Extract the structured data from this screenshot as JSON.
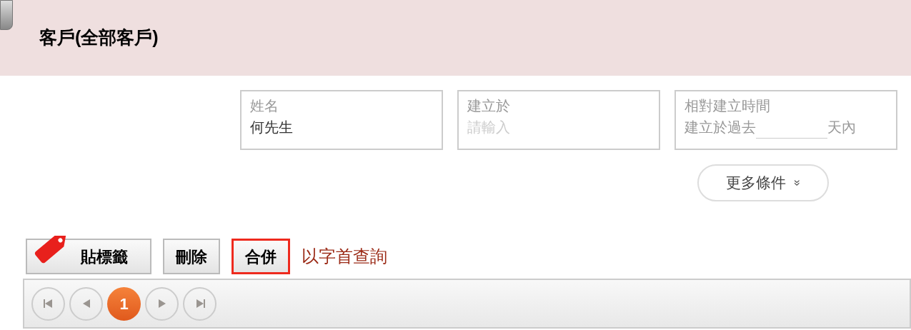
{
  "header": {
    "title": "客戶(全部客戶)"
  },
  "filters": [
    {
      "kind": "text",
      "label": "姓名",
      "value": "何先生"
    },
    {
      "kind": "text",
      "label": "建立於",
      "placeholder": "請輸入"
    },
    {
      "kind": "relative",
      "label": "相對建立時間",
      "prefix": "建立於過去",
      "suffix": "天內"
    }
  ],
  "more_button": {
    "label": "更多條件",
    "icon": "»"
  },
  "actions": [
    {
      "kind": "tag",
      "label": "貼標籤",
      "highlighted": false
    },
    {
      "kind": "plain",
      "label": "刪除",
      "highlighted": false
    },
    {
      "kind": "plain",
      "label": "合併",
      "highlighted": true
    }
  ],
  "initial_search_link": "以字首查詢",
  "pager": {
    "pages": [
      {
        "label": "1",
        "selected": true
      }
    ]
  }
}
